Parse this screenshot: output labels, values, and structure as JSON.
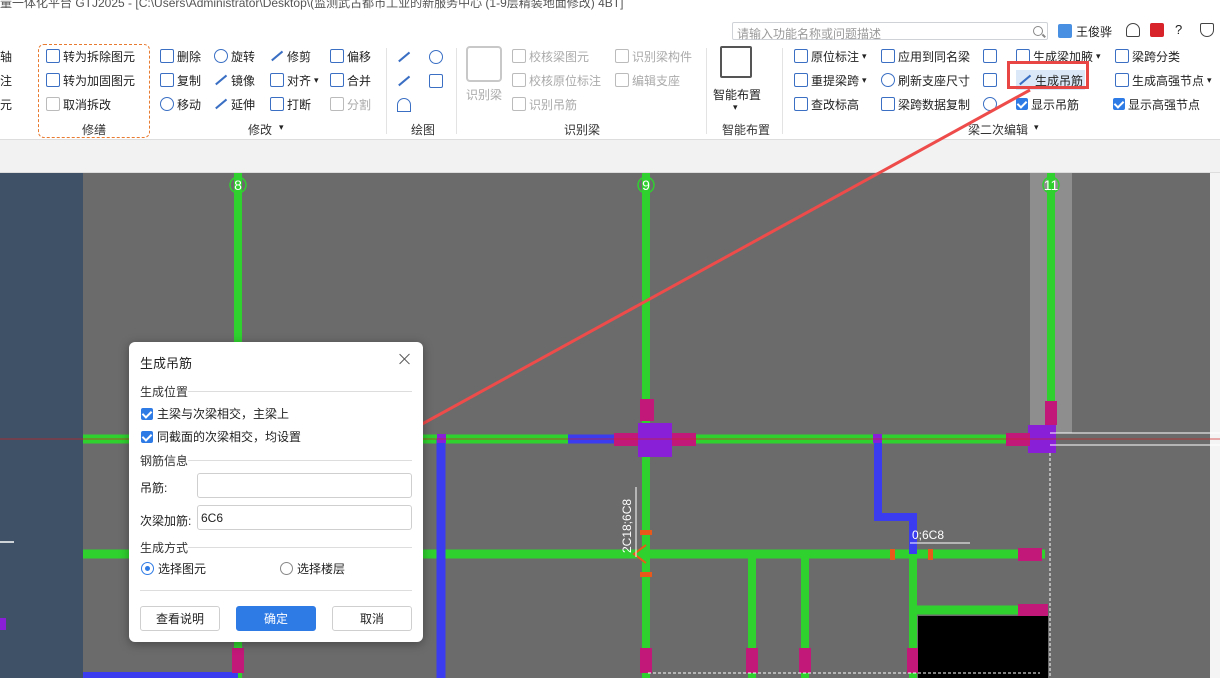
{
  "titlebar": {
    "text": "量一体化平台 GTJ2025 - [C:\\Users\\Administrator\\Desktop\\(监测武古都市工业的新服务中心 (1-9层精装地面修改) 4BT]"
  },
  "search": {
    "placeholder": "请输入功能名称或问题描述"
  },
  "user": {
    "name": "王俊骅"
  },
  "ribbon": {
    "left_partial": [
      "轴",
      "注",
      "元"
    ],
    "repair": {
      "label": "修缮",
      "items": [
        "转为拆除图元",
        "转为加固图元",
        "取消拆改"
      ]
    },
    "modify": {
      "label": "修改",
      "col1": [
        "删除",
        "复制",
        "移动"
      ],
      "col2": [
        "旋转",
        "镜像",
        "延伸"
      ],
      "col3": [
        "修剪",
        "对齐",
        "打断"
      ],
      "col4": [
        "偏移",
        "合并",
        "分割"
      ]
    },
    "draw": {
      "label": "绘图"
    },
    "identify": {
      "label": "识别梁",
      "big": "识别梁",
      "col1": [
        "校核梁图元",
        "校核原位标注",
        "识别吊筋"
      ],
      "col2": [
        "识别梁构件",
        "编辑支座"
      ]
    },
    "smart": {
      "label": "智能布置",
      "big": "智能布置"
    },
    "beam2": {
      "label": "梁二次编辑",
      "col1": [
        "原位标注",
        "重提梁跨",
        "查改标高"
      ],
      "col2": [
        "应用到同名梁",
        "刷新支座尺寸",
        "梁跨数据复制"
      ],
      "col3": [
        "生成梁加腋",
        "生成吊筋",
        "显示吊筋"
      ],
      "col4": [
        "梁跨分类",
        "生成高强节点",
        "显示高强节点"
      ]
    }
  },
  "canvas": {
    "axes": [
      "8",
      "9",
      "11"
    ],
    "annotation_1": "2C18;6C8",
    "annotation_2": "0;6C8"
  },
  "dialog": {
    "title": "生成吊筋",
    "section_position": "生成位置",
    "opt1": "主梁与次梁相交，主梁上",
    "opt2": "同截面的次梁相交，均设置",
    "section_rebar": "钢筋信息",
    "hanger_label": "吊筋:",
    "hanger_value": "",
    "secondary_label": "次梁加筋:",
    "secondary_value": "6C6",
    "section_method": "生成方式",
    "radio1": "选择图元",
    "radio2": "选择楼层",
    "btn_help": "查看说明",
    "btn_ok": "确定",
    "btn_cancel": "取消"
  },
  "colors": {
    "beam": "#2fd12f",
    "secondary": "#3b3bf0",
    "column": "#8a1fd8",
    "support": "#c2187a",
    "arrow": "#ee4b4b"
  }
}
